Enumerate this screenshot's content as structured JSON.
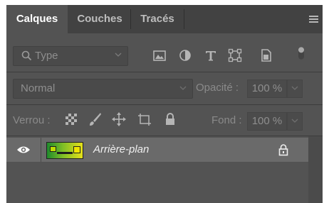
{
  "tabs": [
    {
      "label": "Calques",
      "active": true
    },
    {
      "label": "Couches",
      "active": false
    },
    {
      "label": "Tracés",
      "active": false
    }
  ],
  "filter": {
    "kind_label": "Type",
    "icons": [
      "image-filter-icon",
      "adjustment-filter-icon",
      "text-filter-icon",
      "shape-filter-icon",
      "smart-object-filter-icon",
      "filter-toggle-icon"
    ]
  },
  "blend": {
    "mode": "Normal",
    "opacity_label": "Opacité :",
    "opacity_value": "100 %"
  },
  "lock": {
    "label": "Verrou :",
    "icons": [
      "lock-transparent-pixels-icon",
      "lock-image-pixels-icon",
      "lock-position-icon",
      "lock-artboard-icon",
      "lock-all-icon"
    ],
    "fill_label": "Fond :",
    "fill_value": "100 %"
  },
  "layers": [
    {
      "name": "Arrière-plan",
      "visible": true,
      "locked": true
    }
  ],
  "colors": {
    "panel": "#535353",
    "tabbar": "#424242",
    "selected_row": "#6a6a6a"
  }
}
